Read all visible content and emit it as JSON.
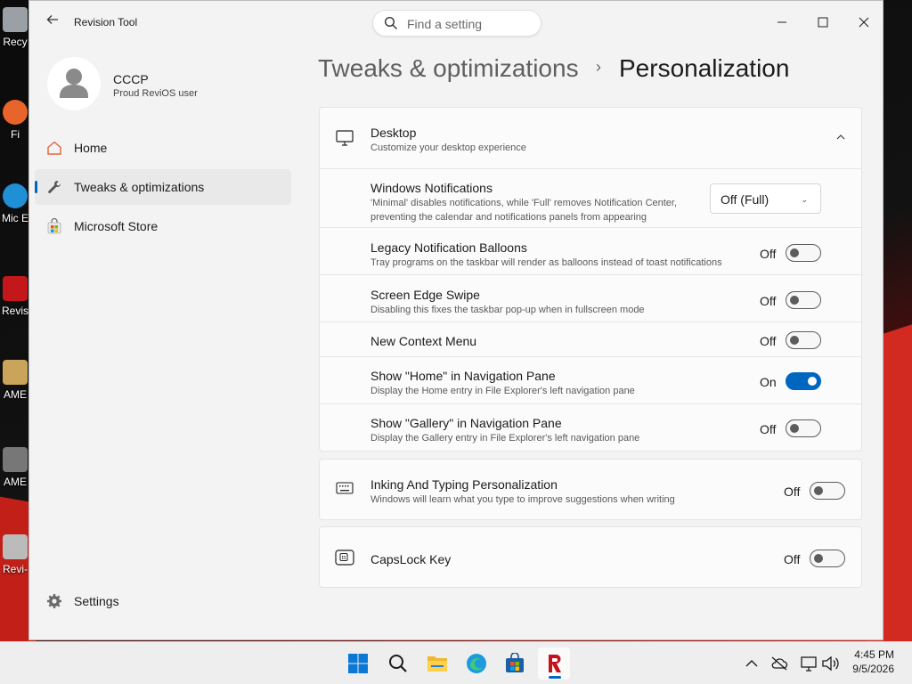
{
  "desktop": {
    "icons": [
      {
        "label": "Recy",
        "color": "#9aa0a6"
      },
      {
        "label": "Fi",
        "color": "#e8642b"
      },
      {
        "label": "Mic E",
        "color": "#1f8fd6"
      },
      {
        "label": "Revis",
        "color": "#c4171c"
      },
      {
        "label": "AME",
        "color": "#c9a45a"
      },
      {
        "label": "AME",
        "color": "#777777"
      },
      {
        "label": "Revi-",
        "color": "#bbbbbb"
      }
    ]
  },
  "window": {
    "app_title": "Revision Tool",
    "search_placeholder": "Find a setting"
  },
  "profile": {
    "name": "CCCP",
    "subtitle": "Proud ReviOS user"
  },
  "nav": {
    "items": [
      {
        "label": "Home",
        "icon": "home-icon"
      },
      {
        "label": "Tweaks & optimizations",
        "icon": "wrench-icon",
        "active": true
      },
      {
        "label": "Microsoft Store",
        "icon": "store-icon"
      }
    ],
    "settings_label": "Settings"
  },
  "breadcrumb": {
    "parent": "Tweaks & optimizations",
    "separator": "›",
    "current": "Personalization"
  },
  "desktop_card": {
    "title": "Desktop",
    "desc": "Customize your desktop experience",
    "expanded": true,
    "settings": [
      {
        "title": "Windows Notifications",
        "desc": "'Minimal' disables notifications, while 'Full' removes Notification Center,",
        "desc2": "preventing the calendar and notifications panels from appearing",
        "control": "dropdown",
        "value": "Off (Full)"
      },
      {
        "title": "Legacy Notification Balloons",
        "desc": "Tray programs on the taskbar will render as balloons instead of toast notifications",
        "control": "toggle",
        "state": "Off"
      },
      {
        "title": "Screen Edge Swipe",
        "desc": "Disabling this fixes the taskbar pop-up when in fullscreen mode",
        "control": "toggle",
        "state": "Off"
      },
      {
        "title": "New Context Menu",
        "desc": "",
        "control": "toggle",
        "state": "Off"
      },
      {
        "title": "Show \"Home\" in Navigation Pane",
        "desc": "Display the Home entry in File Explorer's left navigation pane",
        "control": "toggle",
        "state": "On"
      },
      {
        "title": "Show \"Gallery\" in Navigation Pane",
        "desc": "Display the Gallery entry in File Explorer's left navigation pane",
        "control": "toggle",
        "state": "Off"
      }
    ]
  },
  "inking_card": {
    "title": "Inking And Typing Personalization",
    "desc": "Windows will learn what you type to improve suggestions when writing",
    "state": "Off"
  },
  "capslock_card": {
    "title": "CapsLock Key",
    "state": "Off"
  },
  "taskbar": {
    "apps": [
      "start-icon",
      "search-icon",
      "file-explorer-icon",
      "edge-icon",
      "store-icon",
      "revision-tool-icon"
    ],
    "time": "4:45 PM",
    "date": "9/5/2026"
  },
  "colors": {
    "accent": "#0067c0",
    "window_bg": "#f3f3f3",
    "card_bg": "#fbfbfb"
  }
}
